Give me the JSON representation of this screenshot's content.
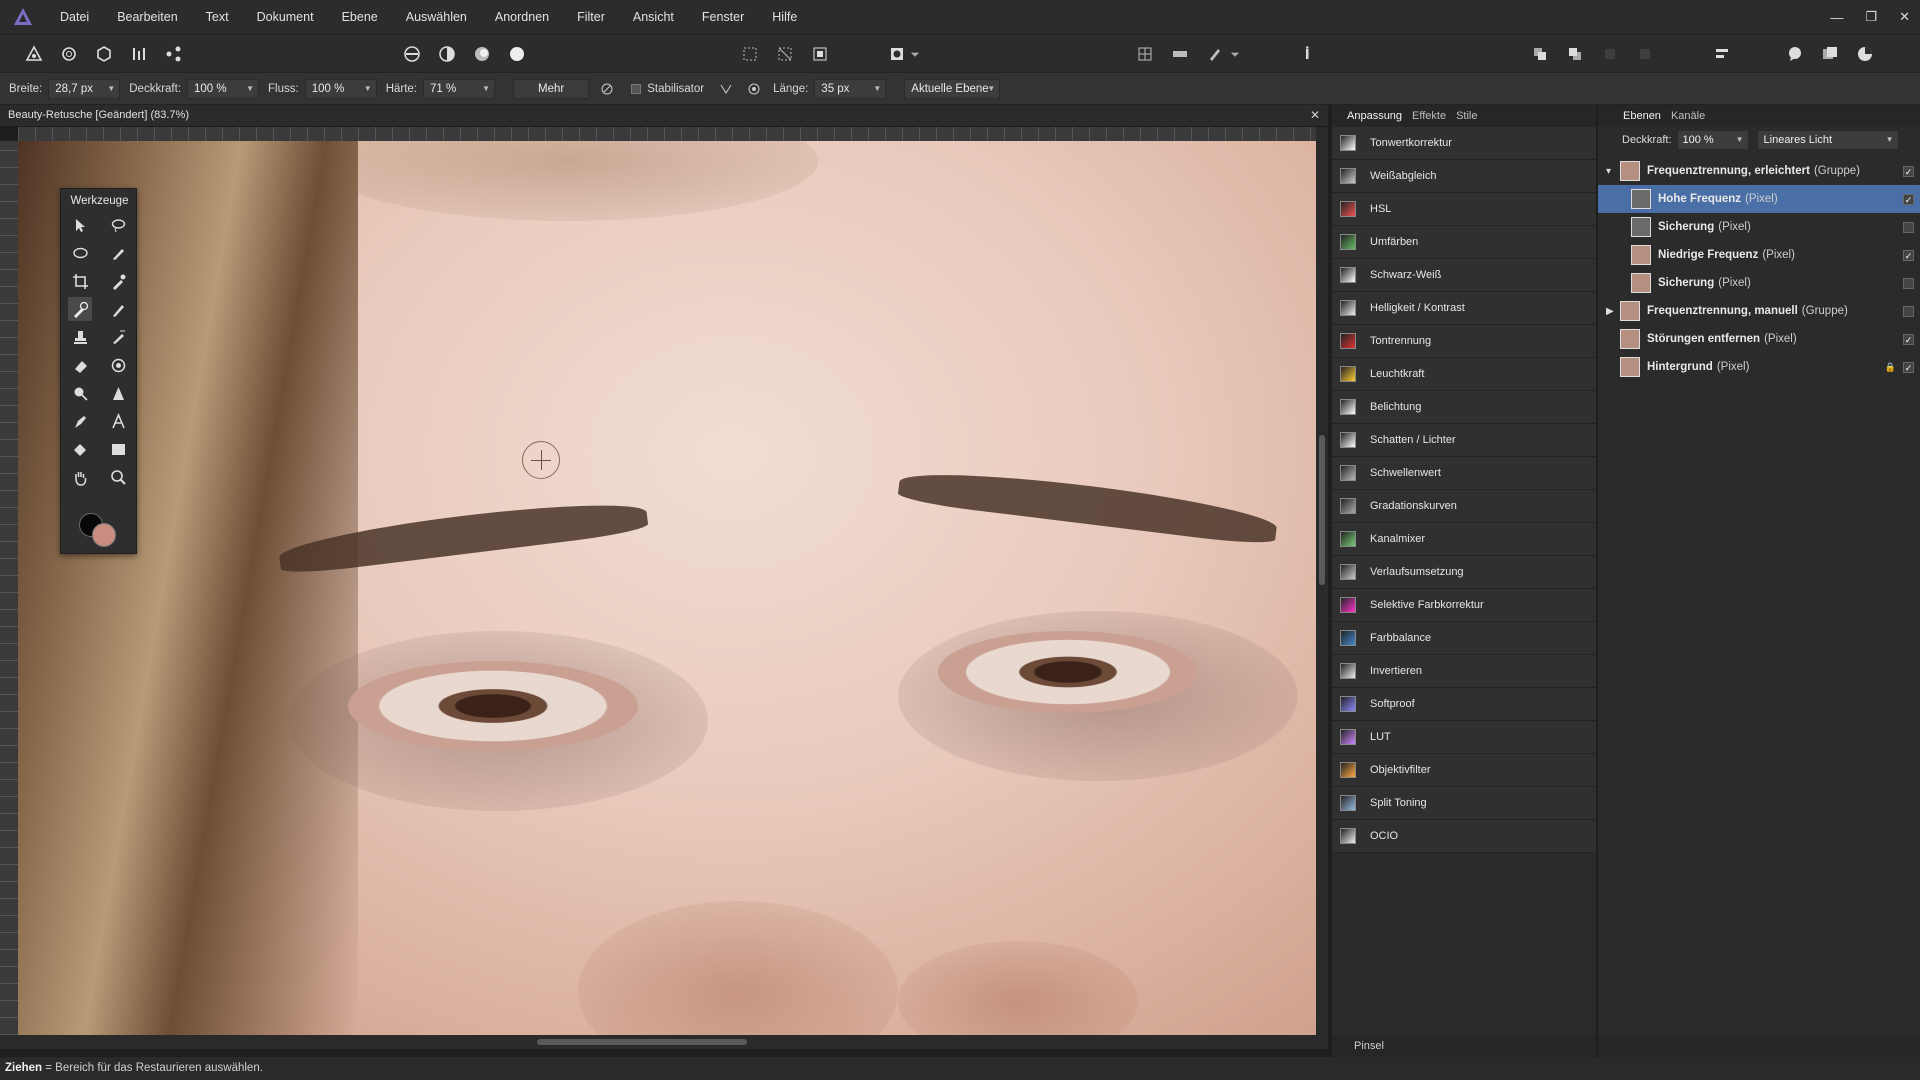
{
  "app": {
    "accent": "#7e6cc7"
  },
  "menu": [
    "Datei",
    "Bearbeiten",
    "Text",
    "Dokument",
    "Ebene",
    "Auswählen",
    "Anordnen",
    "Filter",
    "Ansicht",
    "Fenster",
    "Hilfe"
  ],
  "window_controls": {
    "minimize": "—",
    "restore": "❐",
    "close": "✕"
  },
  "context": {
    "width_label": "Breite:",
    "width_value": "28,7 px",
    "opacity_label": "Deckkraft:",
    "opacity_value": "100 %",
    "flow_label": "Fluss:",
    "flow_value": "100 %",
    "hardness_label": "Härte:",
    "hardness_value": "71 %",
    "more_label": "Mehr",
    "stabilizer_label": "Stabilisator",
    "length_label": "Länge:",
    "length_value": "35 px",
    "layer_scope": "Aktuelle Ebene"
  },
  "document": {
    "title": "Beauty-Retusche [Geändert] (83.7%)",
    "close": "✕"
  },
  "tools_panel": {
    "title": "Werkzeuge",
    "foreground_color": "#c98c80",
    "background_color": "#080808"
  },
  "adjustments": {
    "tabs": [
      "Anpassung",
      "Effekte",
      "Stile"
    ],
    "items": [
      "Tonwertkorrektur",
      "Weißabgleich",
      "HSL",
      "Umfärben",
      "Schwarz-Weiß",
      "Helligkeit / Kontrast",
      "Tontrennung",
      "Leuchtkraft",
      "Belichtung",
      "Schatten / Lichter",
      "Schwellenwert",
      "Gradationskurven",
      "Kanalmixer",
      "Verlaufsumsetzung",
      "Selektive Farbkorrektur",
      "Farbbalance",
      "Invertieren",
      "Softproof",
      "LUT",
      "Objektivfilter",
      "Split Toning",
      "OCIO"
    ],
    "brush_label": "Pinsel"
  },
  "layers": {
    "tabs": [
      "Ebenen",
      "Kanäle"
    ],
    "opacity_label": "Deckkraft:",
    "opacity_value": "100 %",
    "blend_mode": "Lineares Licht",
    "items": [
      {
        "name": "Frequenztrennung, erleichtert",
        "type": "(Gruppe)",
        "expander": "▾",
        "visible": "✓"
      },
      {
        "name": "Hohe Frequenz",
        "type": "(Pixel)",
        "expander": "",
        "visible": "✓"
      },
      {
        "name": "Sicherung",
        "type": "(Pixel)",
        "expander": "",
        "visible": ""
      },
      {
        "name": "Niedrige Frequenz",
        "type": "(Pixel)",
        "expander": "",
        "visible": "✓"
      },
      {
        "name": "Sicherung",
        "type": "(Pixel)",
        "expander": "",
        "visible": ""
      },
      {
        "name": "Frequenztrennung, manuell",
        "type": "(Gruppe)",
        "expander": "▶",
        "visible": ""
      },
      {
        "name": "Störungen entfernen",
        "type": "(Pixel)",
        "expander": "",
        "visible": "✓"
      },
      {
        "name": "Hintergrund",
        "type": "(Pixel)",
        "expander": "",
        "visible": "✓"
      }
    ]
  },
  "status": {
    "action": "Ziehen",
    "hint": " = Bereich für das Restaurieren auswählen."
  }
}
